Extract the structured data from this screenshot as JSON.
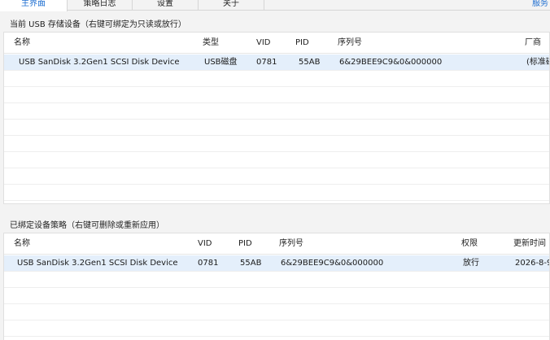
{
  "tabs": [
    "主界面",
    "策略日志",
    "设置",
    "关于"
  ],
  "tab_right_label": "服务",
  "current": {
    "title": "当前 USB 存储设备（右键可绑定为只读或放行）",
    "columns": [
      "名称",
      "类型",
      "VID",
      "PID",
      "序列号",
      "厂商"
    ],
    "rows": [
      {
        "name": "USB  SanDisk 3.2Gen1 SCSI Disk Device",
        "type": "USB磁盘",
        "vid": "0781",
        "pid": "55AB",
        "serial": "6&29BEE9C9&0&000000",
        "vendor": "(标准磁"
      }
    ]
  },
  "bound": {
    "title": "已绑定设备策略（右键可删除或重新应用）",
    "columns": [
      "名称",
      "VID",
      "PID",
      "序列号",
      "权限",
      "更新时间"
    ],
    "rows": [
      {
        "name": "USB  SanDisk 3.2Gen1 SCSI Disk Device",
        "vid": "0781",
        "pid": "55AB",
        "serial": "6&29BEE9C9&0&000000",
        "permission": "放行",
        "updated": "2026-8-9"
      }
    ]
  },
  "colors": {
    "accent": "#1f6fd1",
    "selected_row": "#e4effb"
  }
}
